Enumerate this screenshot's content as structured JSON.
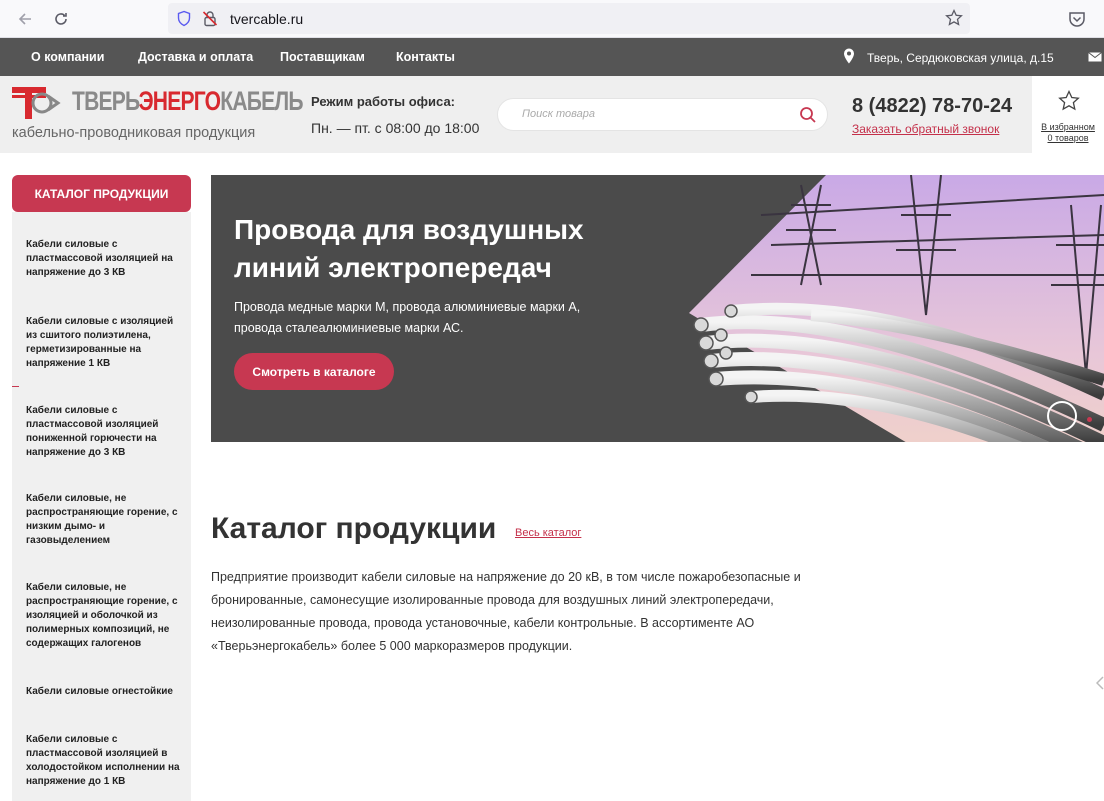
{
  "browser": {
    "url": "tvercable.ru"
  },
  "topnav": {
    "links": [
      "О компании",
      "Доставка и оплата",
      "Поставщикам",
      "Контакты"
    ],
    "address": "Тверь, Сердюковская улица, д.15"
  },
  "header": {
    "logo_word_1": "ТВЕРЬ",
    "logo_word_2": "ЭНЕРГО",
    "logo_word_3": "КАБЕЛЬ",
    "logo_subtitle": "кабельно-проводниковая продукция",
    "hours_title": "Режим работы офиса:",
    "hours_value": "Пн. — пт. с 08:00 до 18:00",
    "search_placeholder": "Поиск товара",
    "phone": "8 (4822) 78-70-24",
    "callback": "Заказать обратный звонок",
    "favorites_label": "В избранном",
    "favorites_count": "0 товаров"
  },
  "sidebar": {
    "catalog_button": "КАТАЛОГ ПРОДУКЦИИ",
    "items": [
      "Кабели силовые с пластмассовой изоляцией на напряжение до 3 КВ",
      "Кабели силовые с изоляцией из сшитого полиэтилена, герметизированные на напряжение 1 КВ",
      "Кабели силовые с пластмассовой изоляцией пониженной горючести на напряжение до 3 КВ",
      "Кабели силовые, не распространяющие горение, с низким дымо- и газовыделением",
      "Кабели силовые, не распространяющие горение, с изоляцией и оболочкой из полимерных композиций, не содержащих галогенов",
      "Кабели силовые огнестойкие",
      "Кабели силовые с пластмассовой изоляцией в холодостойком исполнении на напряжение до 1 КВ"
    ]
  },
  "hero": {
    "title": "Провода для воздушных линий электропередач",
    "description": "Провода медные марки М, провода алюминиевые марки А, провода сталеалюминиевые марки АС.",
    "button": "Смотреть в каталоге"
  },
  "catalog": {
    "title": "Каталог продукции",
    "all_link": "Весь каталог",
    "text": "Предприятие производит кабели силовые на напряжение до 20 кВ, в том числе пожаробезопасные и бронированные, самонесущие изолированные провода для воздушных линий электропередачи, неизолированные провода, провода установочные, кабели контрольные. В ассортименте АО «Тверьэнергокабель» более 5 000 маркоразмеров продукции."
  },
  "colors": {
    "accent": "#c73851",
    "topnav_bg": "#555555",
    "hero_bg": "#4b4b4b",
    "header_bg": "#efefef"
  }
}
